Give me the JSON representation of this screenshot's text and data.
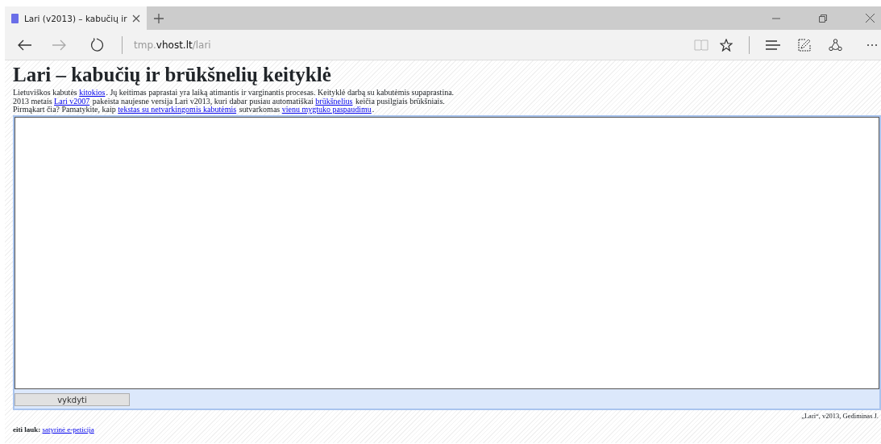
{
  "browser": {
    "tab": {
      "title": "Lari (v2013) – kabučių ir"
    },
    "address": {
      "prefix": "tmp.",
      "host": "vhost.lt",
      "path": "/lari"
    }
  },
  "page": {
    "title": "Lari – kabučių ir brūkšnelių keityklė",
    "intro": [
      [
        {
          "kind": "text",
          "text": "Lietuviškos kabutės "
        },
        {
          "kind": "link",
          "text": "kitokios"
        },
        {
          "kind": "text",
          "text": ". Jų keitimas paprastai yra laiką atimantis ir varginantis procesas. Keityklė darbą su kabutėmis supaprastina."
        }
      ],
      [
        {
          "kind": "text",
          "text": "2013 metais "
        },
        {
          "kind": "link",
          "text": "Lari v2007"
        },
        {
          "kind": "text",
          "text": " pakeista naujesne versija Lari v2013, kuri dabar pusiau automatiškai "
        },
        {
          "kind": "link",
          "text": "brūkšnelius"
        },
        {
          "kind": "text",
          "text": " keičia pusilgiais brūkšniais."
        }
      ],
      [
        {
          "kind": "text",
          "text": "Pirmąkart čia? Pamatykite, kaip "
        },
        {
          "kind": "link",
          "text": "tekstas su netvarkingomis kabutėmis"
        },
        {
          "kind": "text",
          "text": " sutvarkomas "
        },
        {
          "kind": "link",
          "text": "vienu mygtuko paspaudimu"
        },
        {
          "kind": "text",
          "text": "."
        }
      ]
    ],
    "run_button": "vykdyti",
    "credit": "„Lari“, v2013, Gediminas J.",
    "footer": {
      "label": "eiti lauk:",
      "link": "satyrinė e-peticija"
    }
  }
}
